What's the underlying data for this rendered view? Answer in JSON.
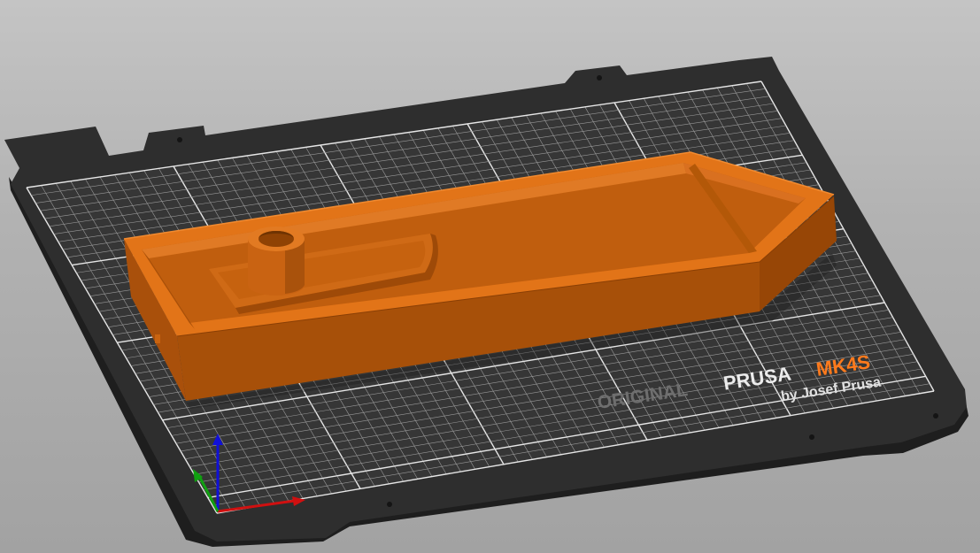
{
  "viewport": {
    "name": "3D view",
    "background_top": "#c4c4c4",
    "background_bottom": "#a2a2a2"
  },
  "bed": {
    "model_prefix": "ORIGINAL",
    "model_brand": "PRUSA",
    "model_name": "MK4S",
    "maker_line": "by Josef Prusa",
    "sheet_color": "#2f2f2f",
    "grid_color": "#ffffff",
    "accent_color": "#ff7a1c"
  },
  "object": {
    "color": "#d46a14",
    "shape": "pointed tray with cylindrical post"
  },
  "axes": {
    "x_color": "#d01010",
    "y_color": "#10a010",
    "z_color": "#1010d8",
    "icons": [
      "x-axis-arrow-icon",
      "y-axis-arrow-icon",
      "z-axis-arrow-icon"
    ]
  }
}
